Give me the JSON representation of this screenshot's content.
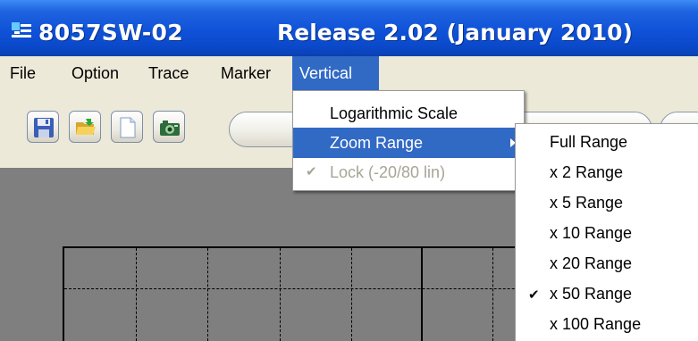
{
  "window": {
    "title": "8057SW-02",
    "release": "Release 2.02 (January 2010)"
  },
  "menubar": {
    "items": [
      {
        "label": "File"
      },
      {
        "label": "Option"
      },
      {
        "label": "Trace"
      },
      {
        "label": "Marker"
      },
      {
        "label": "Vertical",
        "active": true
      }
    ]
  },
  "toolbar": {
    "buttons": [
      {
        "icon": "save-icon"
      },
      {
        "icon": "open-folder-icon"
      },
      {
        "icon": "new-document-icon"
      },
      {
        "icon": "camera-icon"
      }
    ]
  },
  "vertical_menu": {
    "items": [
      {
        "label": "Logarithmic Scale",
        "state": "normal"
      },
      {
        "label": "Zoom Range",
        "state": "highlighted",
        "has_submenu": true
      },
      {
        "label": "Lock (-20/80 lin)",
        "state": "disabled",
        "checked": true
      }
    ]
  },
  "zoom_submenu": {
    "items": [
      {
        "label": "Full Range",
        "checked": false
      },
      {
        "label": "x 2 Range",
        "checked": false
      },
      {
        "label": "x 5 Range",
        "checked": false
      },
      {
        "label": "x 10 Range",
        "checked": false
      },
      {
        "label": "x 20 Range",
        "checked": false
      },
      {
        "label": "x 50 Range",
        "checked": true
      },
      {
        "label": "x 100 Range",
        "checked": false
      }
    ]
  },
  "colors": {
    "titlebar": "#0f52d8",
    "menu_highlight": "#316ac5",
    "chrome": "#ece9d8",
    "plot_background": "#7f7f7f"
  }
}
